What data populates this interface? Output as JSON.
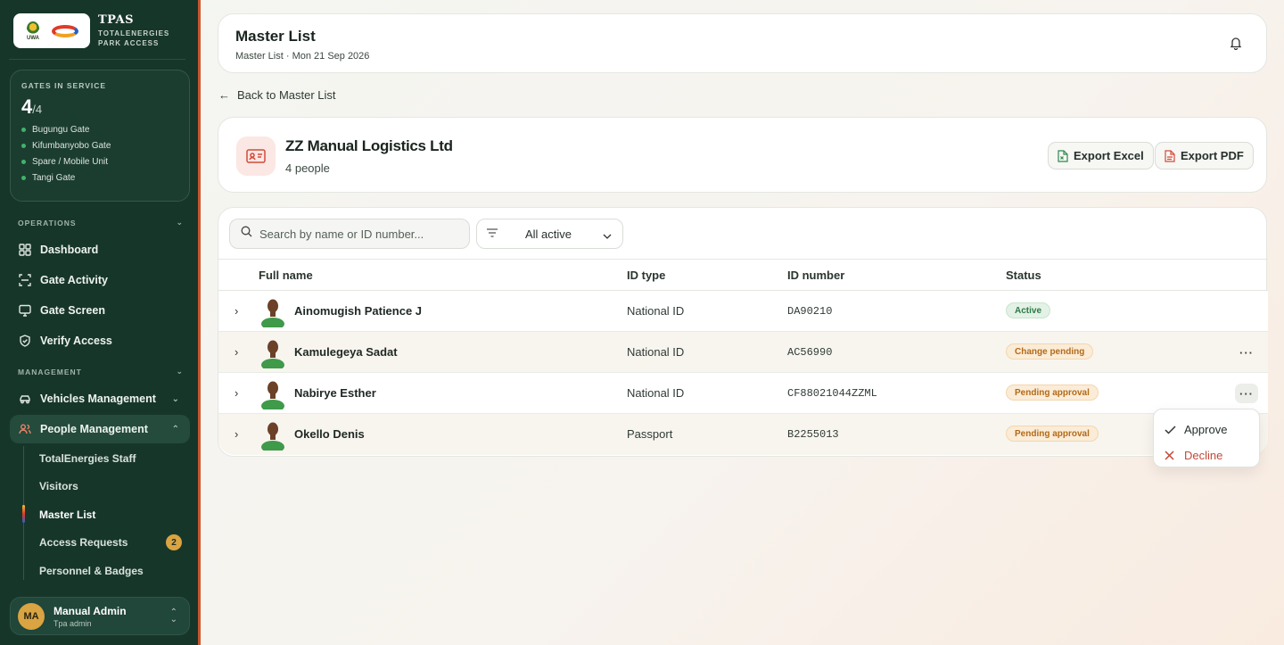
{
  "brand": {
    "title": "TPAS",
    "subtitle_line1": "TOTALENERGIES",
    "subtitle_line2": "PARK ACCESS",
    "uwa_logo_text": "UWA"
  },
  "gates": {
    "label": "GATES IN SERVICE",
    "count": "4",
    "total": "/4",
    "items": [
      "Bugungu Gate",
      "Kifumbanyobo Gate",
      "Spare / Mobile Unit",
      "Tangi Gate"
    ]
  },
  "sidebar": {
    "operations_label": "OPERATIONS",
    "operations": [
      {
        "label": "Dashboard",
        "icon": "grid-icon"
      },
      {
        "label": "Gate Activity",
        "icon": "scan-icon"
      },
      {
        "label": "Gate Screen",
        "icon": "monitor-icon"
      },
      {
        "label": "Verify Access",
        "icon": "shield-check-icon"
      }
    ],
    "management_label": "MANAGEMENT",
    "vehicles": "Vehicles Management",
    "people": "People Management",
    "people_sub": [
      "TotalEnergies Staff",
      "Visitors",
      "Master List",
      "Access Requests",
      "Personnel & Badges"
    ],
    "access_requests_count": "2"
  },
  "user": {
    "initials": "MA",
    "name": "Manual Admin",
    "role": "Tpa admin"
  },
  "header": {
    "title": "Master List",
    "subtitle": "Master List · Mon 21 Sep 2026"
  },
  "back_link": "Back to Master List",
  "org": {
    "name": "ZZ Manual Logistics Ltd",
    "people": "4 people",
    "export_excel": "Export Excel",
    "export_pdf": "Export PDF"
  },
  "table": {
    "search_placeholder": "Search by name or ID number...",
    "filter_value": "All active",
    "columns": [
      "Full name",
      "ID type",
      "ID number",
      "Status"
    ],
    "rows": [
      {
        "name": "Ainomugish Patience J",
        "id_type": "National ID",
        "id_number": "DA90210",
        "status": "Active"
      },
      {
        "name": "Kamulegeya Sadat",
        "id_type": "National ID",
        "id_number": "AC56990",
        "status": "Change pending"
      },
      {
        "name": "Nabirye Esther",
        "id_type": "National ID",
        "id_number": "CF88021044ZZML",
        "status": "Pending approval"
      },
      {
        "name": "Okello Denis",
        "id_type": "Passport",
        "id_number": "B2255013",
        "status": "Pending approval"
      }
    ]
  },
  "menu": {
    "approve": "Approve",
    "decline": "Decline"
  },
  "colors": {
    "sidebar_bg": "#17362a",
    "accent_gold": "#d9a441",
    "active_green": "#2d7a45",
    "pending_orange": "#b36a18",
    "decline_red": "#c24a3a"
  }
}
